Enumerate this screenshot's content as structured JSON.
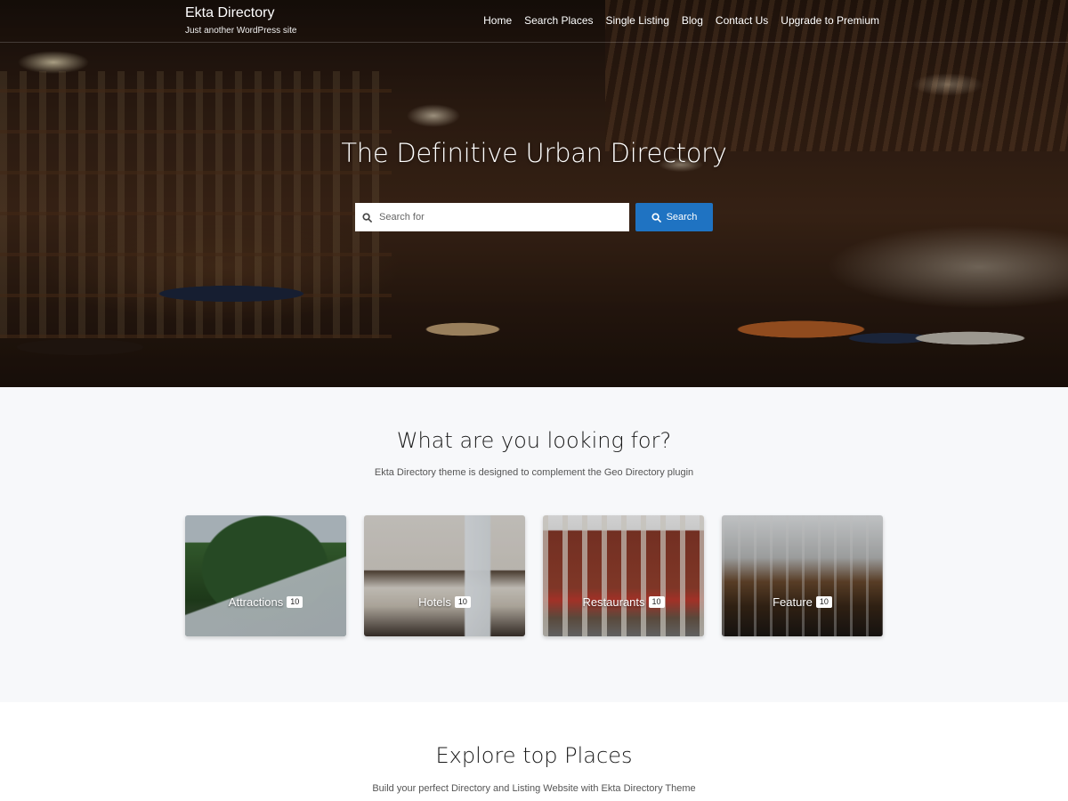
{
  "site": {
    "title": "Ekta Directory",
    "tagline": "Just another WordPress site"
  },
  "nav": {
    "items": [
      {
        "label": "Home"
      },
      {
        "label": "Search Places"
      },
      {
        "label": "Single Listing"
      },
      {
        "label": "Blog"
      },
      {
        "label": "Contact Us"
      },
      {
        "label": "Upgrade to Premium"
      }
    ]
  },
  "hero": {
    "title": "The Definitive Urban Directory",
    "search": {
      "placeholder": "Search for",
      "value": "",
      "button_label": "Search",
      "button_color": "#1f73c2",
      "icon": "search-icon"
    }
  },
  "categories_section": {
    "title": "What are you looking for?",
    "subtitle": "Ekta Directory theme is designed to complement the Geo Directory plugin",
    "items": [
      {
        "name": "Attractions",
        "count": "10"
      },
      {
        "name": "Hotels",
        "count": "10"
      },
      {
        "name": "Restaurants",
        "count": "10"
      },
      {
        "name": "Feature",
        "count": "10"
      }
    ]
  },
  "explore_section": {
    "title": "Explore top Places",
    "subtitle": "Build your perfect Directory and Listing Website with Ekta Directory Theme"
  }
}
